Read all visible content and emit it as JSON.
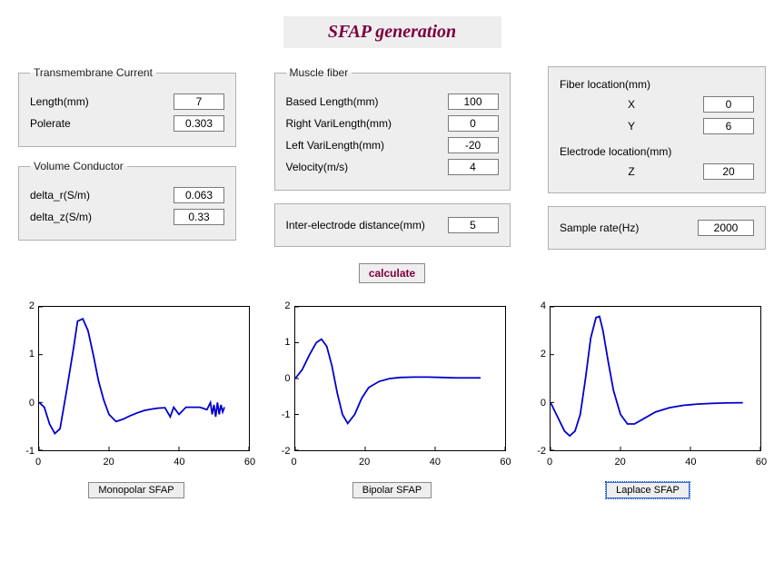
{
  "title": "SFAP generation",
  "groups": {
    "transmembrane": {
      "legend": "Transmembrane Current",
      "length_label": "Length(mm)",
      "length_value": "7",
      "polerate_label": "Polerate",
      "polerate_value": "0.303"
    },
    "volume": {
      "legend": "Volume Conductor",
      "delta_r_label": "delta_r(S/m)",
      "delta_r_value": "0.063",
      "delta_z_label": "delta_z(S/m)",
      "delta_z_value": "0.33"
    },
    "muscle": {
      "legend": "Muscle fiber",
      "based_label": "Based Length(mm)",
      "based_value": "100",
      "right_label": "Right VariLength(mm)",
      "right_value": "0",
      "left_label": "Left VariLength(mm)",
      "left_value": "-20",
      "velocity_label": "Velocity(m/s)",
      "velocity_value": "4"
    },
    "inter": {
      "label": "Inter-electrode distance(mm)",
      "value": "5"
    },
    "loc": {
      "fiber_label": "Fiber location(mm)",
      "x_label": "X",
      "x_value": "0",
      "y_label": "Y",
      "y_value": "6",
      "elec_label": "Electrode location(mm)",
      "z_label": "Z",
      "z_value": "20"
    },
    "sample": {
      "label": "Sample rate(Hz)",
      "value": "2000"
    }
  },
  "calculate_label": "calculate",
  "chart_buttons": {
    "mono": "Monopolar SFAP",
    "bi": "Bipolar SFAP",
    "lap": "Laplace SFAP"
  },
  "chart_data": [
    {
      "type": "line",
      "title": "Monopolar SFAP",
      "xlim": [
        0,
        60
      ],
      "ylim": [
        -1,
        2
      ],
      "x_ticks": [
        0,
        20,
        40,
        60
      ],
      "y_ticks": [
        -1,
        0,
        1,
        2
      ],
      "series": [
        {
          "name": "Monopolar",
          "color": "#0000cc",
          "x": [
            0,
            1.5,
            3,
            4.5,
            6,
            8,
            10,
            11,
            12.5,
            14,
            15.5,
            17,
            18.5,
            20,
            22,
            24,
            26,
            28,
            30,
            32,
            34,
            36,
            37.5,
            38.5,
            40,
            42,
            44,
            46,
            48,
            49,
            49.5,
            50,
            50.5,
            51,
            51.5,
            52,
            52.5,
            53
          ],
          "y": [
            0.0,
            -0.1,
            -0.45,
            -0.65,
            -0.55,
            0.3,
            1.2,
            1.7,
            1.75,
            1.5,
            1.0,
            0.45,
            0.05,
            -0.25,
            -0.4,
            -0.35,
            -0.28,
            -0.22,
            -0.17,
            -0.14,
            -0.12,
            -0.11,
            -0.3,
            -0.1,
            -0.25,
            -0.1,
            -0.1,
            -0.1,
            -0.15,
            0.0,
            -0.25,
            -0.05,
            -0.3,
            0.0,
            -0.25,
            -0.05,
            -0.2,
            -0.1
          ]
        }
      ]
    },
    {
      "type": "line",
      "title": "Bipolar SFAP",
      "xlim": [
        0,
        60
      ],
      "ylim": [
        -2,
        2
      ],
      "x_ticks": [
        0,
        20,
        40,
        60
      ],
      "y_ticks": [
        -2,
        -1,
        0,
        1,
        2
      ],
      "series": [
        {
          "name": "Bipolar",
          "color": "#0000cc",
          "x": [
            0,
            2,
            4,
            6,
            7.5,
            9,
            10.5,
            12,
            13.5,
            15,
            17,
            19,
            21,
            24,
            27,
            30,
            34,
            38,
            42,
            46,
            50,
            53
          ],
          "y": [
            0.0,
            0.25,
            0.65,
            1.0,
            1.1,
            0.9,
            0.35,
            -0.4,
            -1.0,
            -1.25,
            -1.0,
            -0.55,
            -0.25,
            -0.08,
            0.0,
            0.03,
            0.04,
            0.04,
            0.03,
            0.02,
            0.02,
            0.02
          ]
        }
      ]
    },
    {
      "type": "line",
      "title": "Laplace SFAP",
      "xlim": [
        0,
        60
      ],
      "ylim": [
        -2,
        4
      ],
      "x_ticks": [
        0,
        20,
        40,
        60
      ],
      "y_ticks": [
        -2,
        0,
        2,
        4
      ],
      "series": [
        {
          "name": "Laplace",
          "color": "#0000cc",
          "x": [
            0,
            2,
            4,
            5.5,
            7,
            8.5,
            10,
            11.5,
            13,
            14,
            15,
            16.5,
            18,
            20,
            22,
            24,
            27,
            30,
            34,
            38,
            42,
            46,
            50,
            55
          ],
          "y": [
            0.0,
            -0.6,
            -1.2,
            -1.4,
            -1.2,
            -0.5,
            1.0,
            2.7,
            3.55,
            3.6,
            3.0,
            1.7,
            0.5,
            -0.5,
            -0.9,
            -0.9,
            -0.65,
            -0.4,
            -0.22,
            -0.12,
            -0.07,
            -0.04,
            -0.02,
            -0.01
          ]
        }
      ]
    }
  ]
}
